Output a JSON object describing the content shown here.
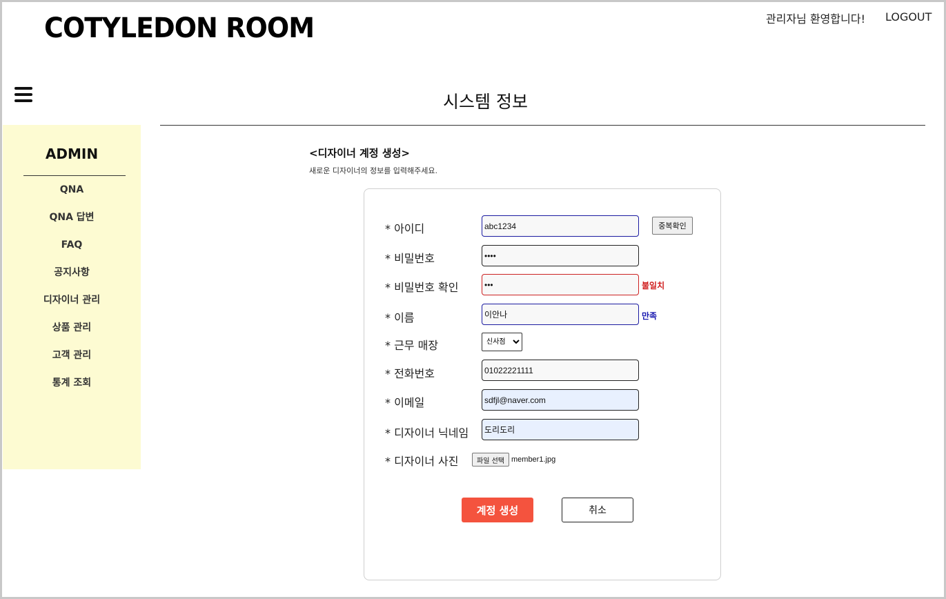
{
  "header": {
    "brand": "COTYLEDON ROOM",
    "welcome": "관리자님 환영합니다!",
    "logout": "LOGOUT"
  },
  "page": {
    "title": "시스템 정보"
  },
  "sidebar": {
    "heading": "ADMIN",
    "items": [
      {
        "label": "QNA"
      },
      {
        "label": "QNA 답변"
      },
      {
        "label": "FAQ"
      },
      {
        "label": "공지사항"
      },
      {
        "label": "디자이너 관리"
      },
      {
        "label": "상품 관리"
      },
      {
        "label": "고객 관리"
      },
      {
        "label": "통계 조회"
      }
    ]
  },
  "section": {
    "title": "<디자이너 계정 생성>",
    "description": "새로운 디자이너의 정보를 입력해주세요."
  },
  "form": {
    "id": {
      "label": "* 아이디",
      "value": "abc1234",
      "check_button": "중복확인"
    },
    "password": {
      "label": "* 비밀번호",
      "value": "abcd"
    },
    "password_confirm": {
      "label": "* 비밀번호 확인",
      "value": "abc",
      "message": "불일치"
    },
    "name": {
      "label": "* 이름",
      "value": "이안나",
      "message": "만족"
    },
    "store": {
      "label": "* 근무 매장",
      "selected": "신사점"
    },
    "phone": {
      "label": "* 전화번호",
      "value": "01022221111"
    },
    "email": {
      "label": "* 이메일",
      "value": "sdfjl@naver.com"
    },
    "nickname": {
      "label": "* 디자이너 닉네임",
      "value": "도리도리"
    },
    "photo": {
      "label": "* 디자이너 사진",
      "button": "파일 선택",
      "file_name": "member1.jpg"
    },
    "submit": "계정 생성",
    "cancel": "취소"
  },
  "colors": {
    "sidebar_bg": "#fdfbd2",
    "submit_bg": "#f4533e",
    "error": "#d02020",
    "ok": "#1a1ab0"
  }
}
